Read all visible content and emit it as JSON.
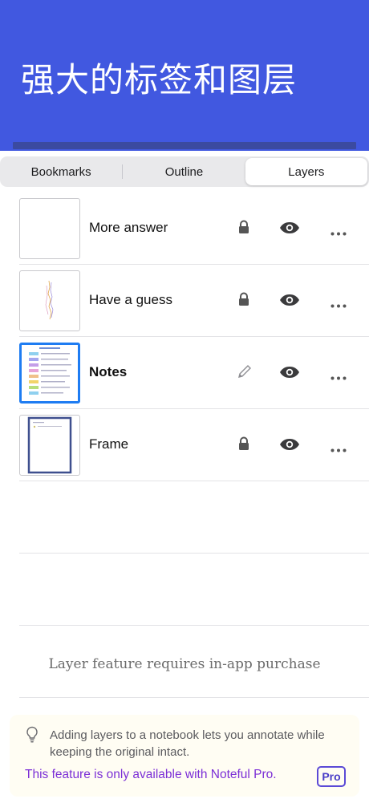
{
  "banner": {
    "title": "强大的标签和图层",
    "accent_color": "#4158e0"
  },
  "tabs": [
    {
      "label": "Bookmarks",
      "active": false
    },
    {
      "label": "Outline",
      "active": false
    },
    {
      "label": "Layers",
      "active": true
    }
  ],
  "layers": [
    {
      "name": "More answer",
      "locked": true,
      "visible": true,
      "selected": false,
      "thumb": "blank"
    },
    {
      "name": "Have a guess",
      "locked": true,
      "visible": true,
      "selected": false,
      "thumb": "sketch"
    },
    {
      "name": "Notes",
      "locked": false,
      "visible": true,
      "selected": true,
      "thumb": "notes"
    },
    {
      "name": "Frame",
      "locked": true,
      "visible": true,
      "selected": false,
      "thumb": "frame"
    }
  ],
  "purchase_notice": "Layer feature requires in-app purchase",
  "tip": {
    "icon": "lightbulb-icon",
    "text": "Adding layers to a notebook lets you annotate while keeping the original intact.",
    "pro_line": "This feature is only available with Noteful Pro.",
    "badge": "Pro"
  }
}
